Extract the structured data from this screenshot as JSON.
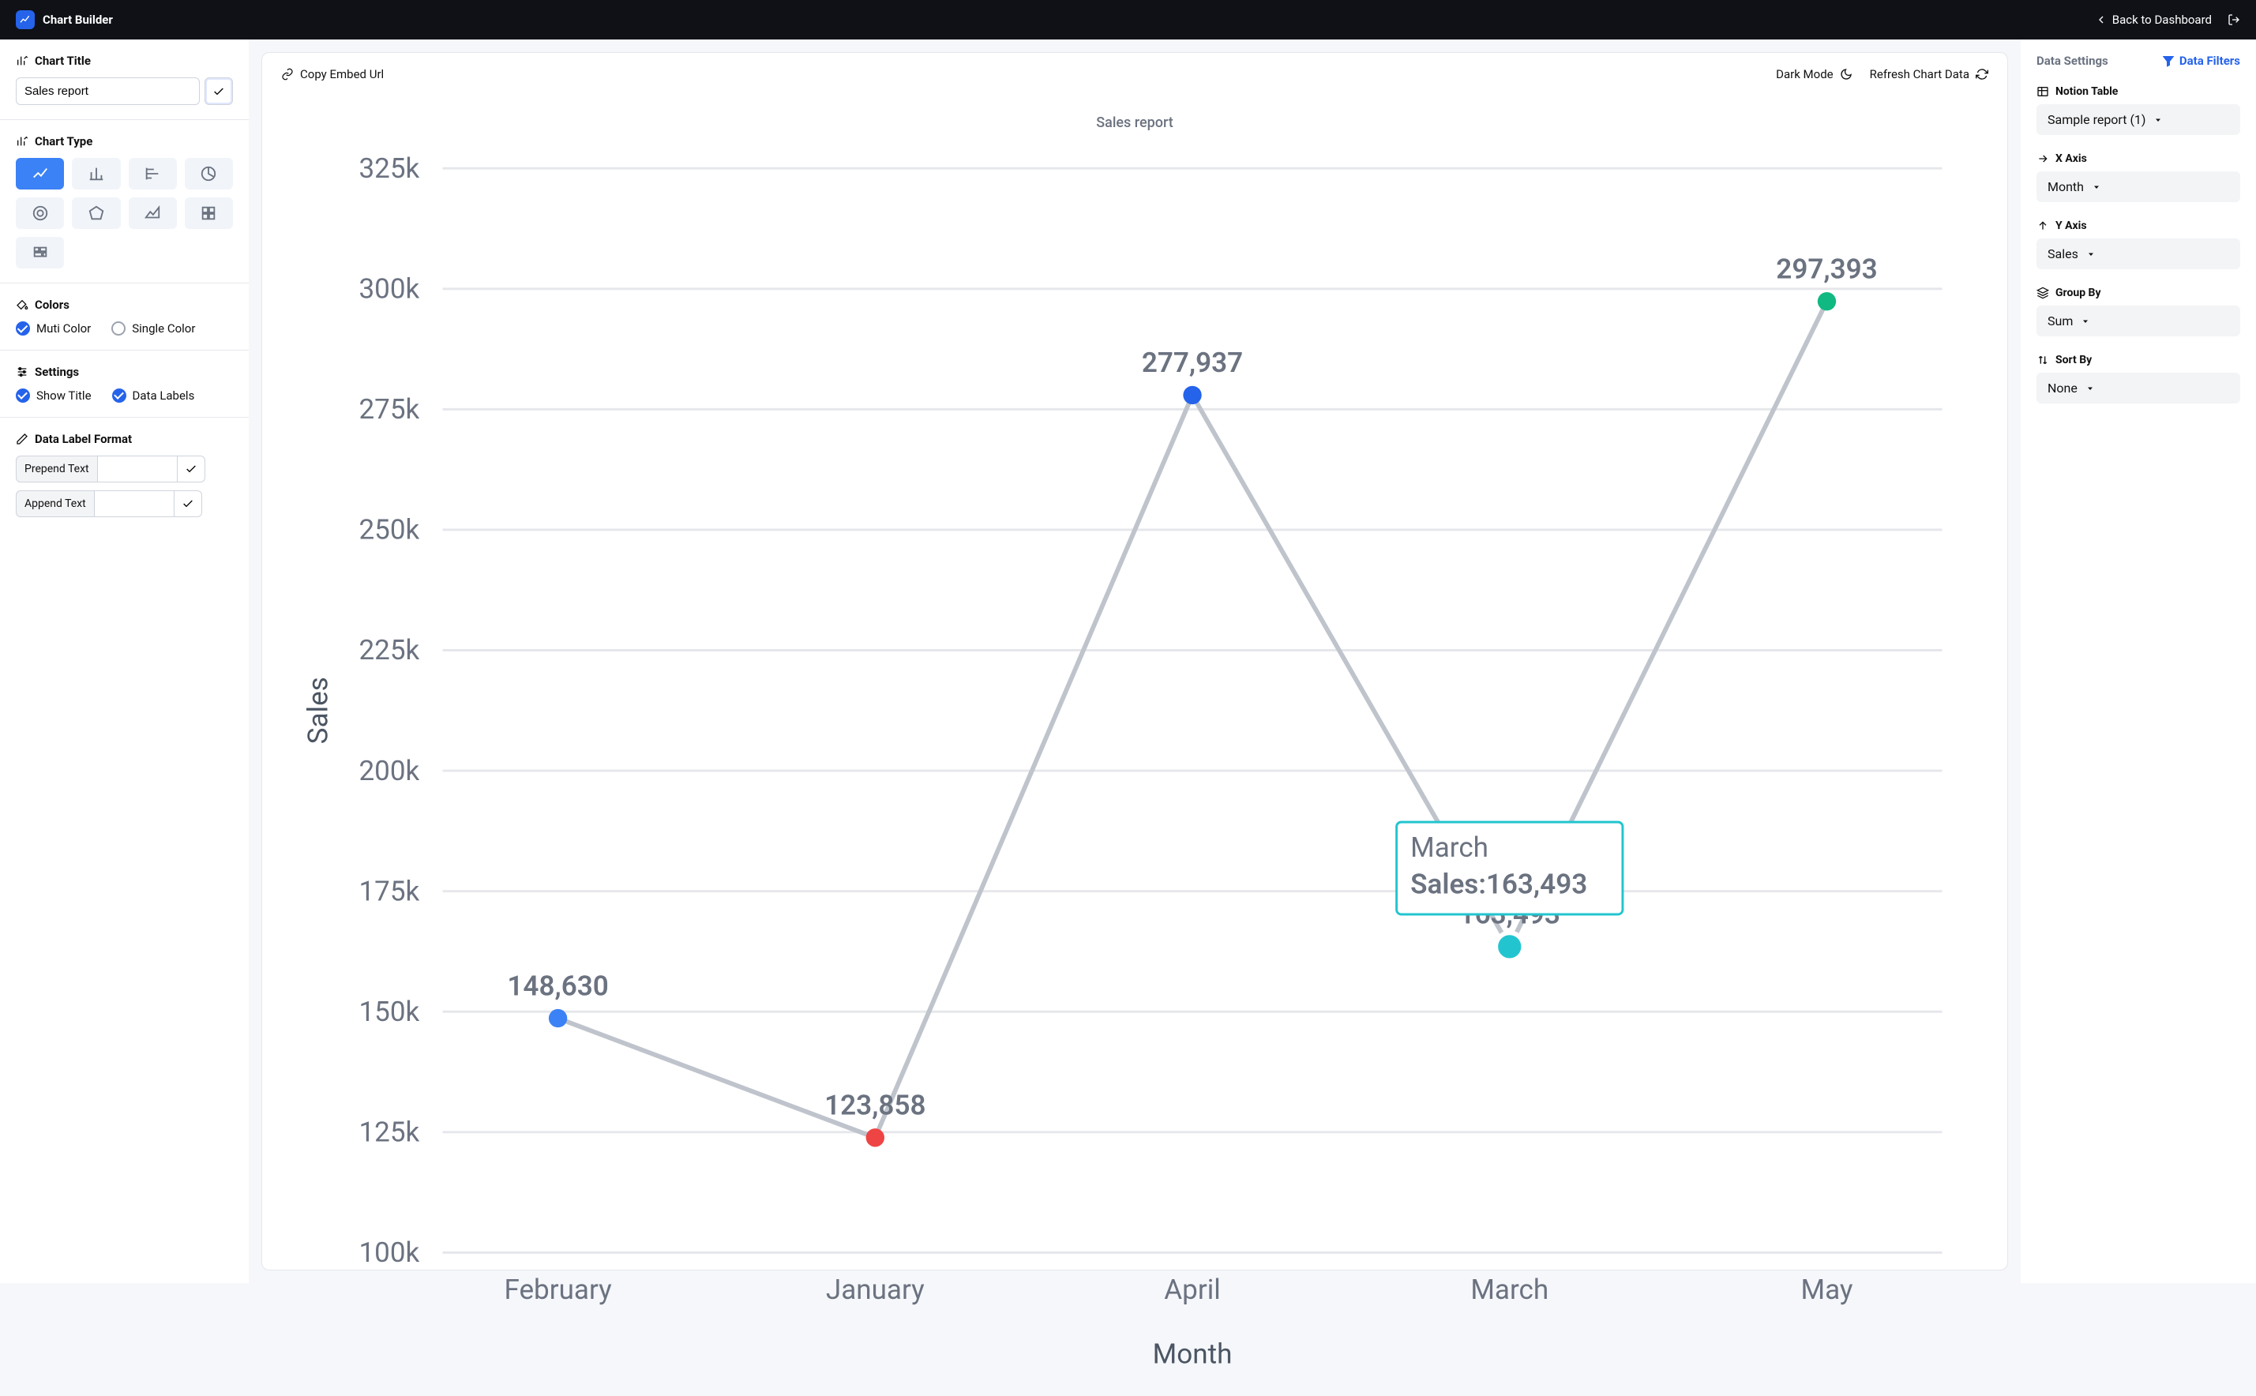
{
  "app_name": "Chart Builder",
  "back_to_dashboard": "Back to Dashboard",
  "left": {
    "chart_title_head": "Chart Title",
    "chart_title_value": "Sales report",
    "chart_type_head": "Chart Type",
    "colors_head": "Colors",
    "colors_opt1": "Muti Color",
    "colors_opt2": "Single Color",
    "settings_head": "Settings",
    "show_title": "Show Title",
    "data_labels": "Data Labels",
    "data_label_format_head": "Data Label Format",
    "prepend_label": "Prepend Text",
    "append_label": "Append Text"
  },
  "toolbar": {
    "copy_embed": "Copy Embed Url",
    "dark_mode": "Dark Mode",
    "refresh": "Refresh Chart Data"
  },
  "right": {
    "tab_data_settings": "Data Settings",
    "tab_data_filters": "Data Filters",
    "notion_table_head": "Notion Table",
    "notion_table_value": "Sample report (1)",
    "x_axis_head": "X Axis",
    "x_axis_value": "Month",
    "y_axis_head": "Y Axis",
    "y_axis_value": "Sales",
    "group_by_head": "Group By",
    "group_by_value": "Sum",
    "sort_by_head": "Sort By",
    "sort_by_value": "None"
  },
  "tooltip": {
    "category": "March",
    "series_label": "Sales:",
    "value": "163,493"
  },
  "chart_data": {
    "type": "line",
    "title": "Sales report",
    "xlabel": "Month",
    "ylabel": "Sales",
    "ylim": [
      100000,
      325000
    ],
    "y_ticks": [
      "100k",
      "125k",
      "150k",
      "175k",
      "200k",
      "225k",
      "250k",
      "275k",
      "300k",
      "325k"
    ],
    "categories": [
      "February",
      "January",
      "April",
      "March",
      "May"
    ],
    "values": [
      148630,
      123858,
      277937,
      163493,
      297393
    ],
    "value_labels": [
      "148,630",
      "123,858",
      "277,937",
      "163,493",
      "297,393"
    ],
    "point_colors": [
      "#3b82f6",
      "#ef4444",
      "#2563eb",
      "#22c5cf",
      "#10b981"
    ],
    "hover_index": 3
  }
}
